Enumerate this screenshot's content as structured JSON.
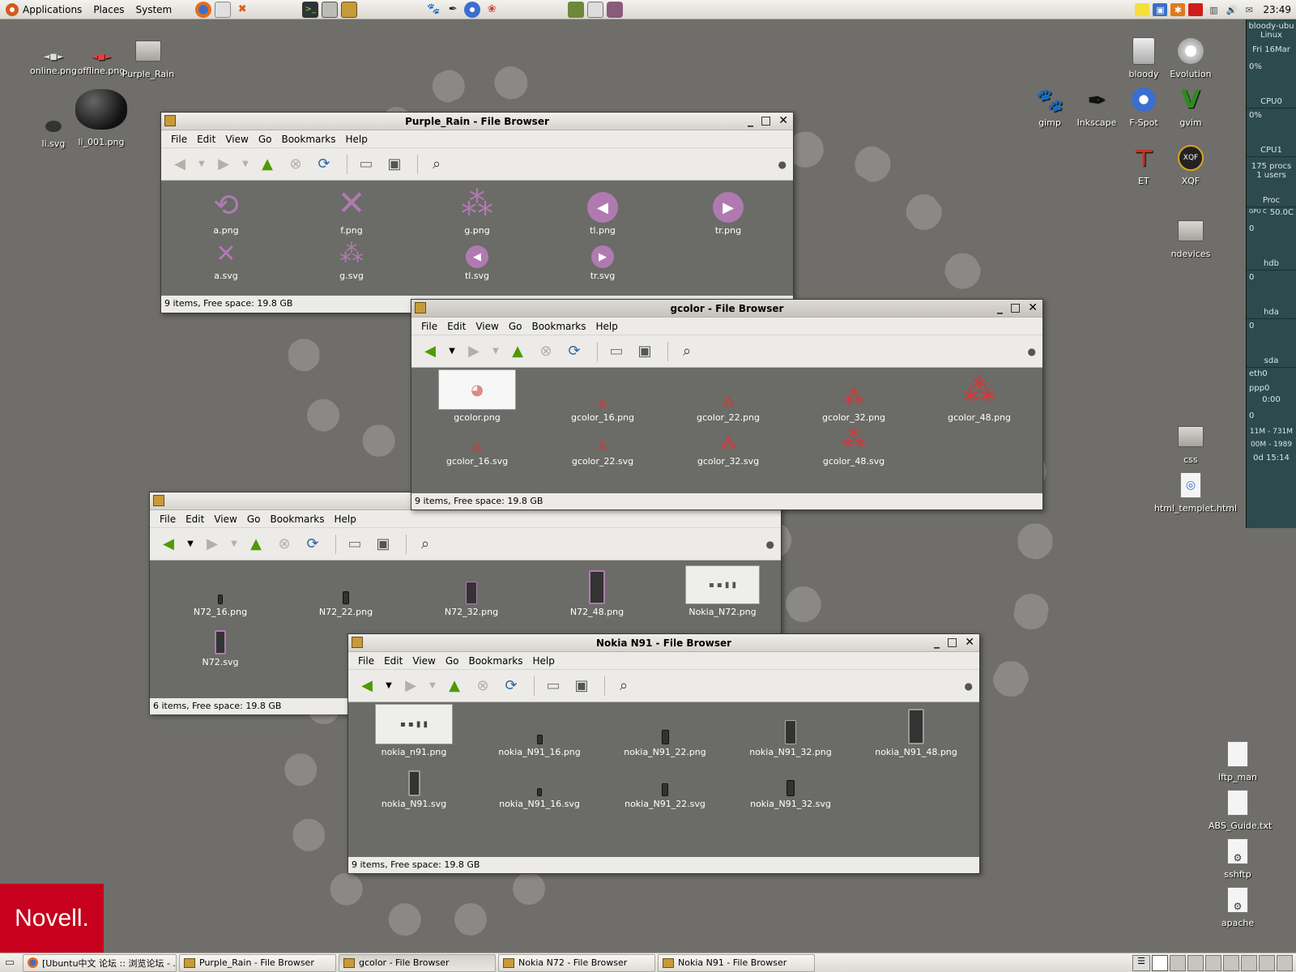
{
  "top_panel": {
    "menus": [
      "Applications",
      "Places",
      "System"
    ],
    "clock": "23:49"
  },
  "desktop_icons_left": [
    {
      "label": "online.png",
      "icon": "image-icon"
    },
    {
      "label": "offline.png",
      "icon": "image-icon"
    },
    {
      "label": "Purple_Rain",
      "icon": "folder-icon"
    },
    {
      "label": "li.svg",
      "icon": "mouse-icon"
    },
    {
      "label": "li_001.png",
      "icon": "mouse-icon"
    }
  ],
  "desktop_icons_right": [
    {
      "label": "bloody",
      "icon": "drive-icon"
    },
    {
      "label": "Evolution",
      "icon": "evolution-icon"
    },
    {
      "label": "gimp",
      "icon": "gimp-icon"
    },
    {
      "label": "Inkscape",
      "icon": "inkscape-icon"
    },
    {
      "label": "F-Spot",
      "icon": "fspot-icon"
    },
    {
      "label": "gvim",
      "icon": "gvim-icon"
    },
    {
      "label": "ET",
      "icon": "et-icon"
    },
    {
      "label": "XQF",
      "icon": "xqf-icon"
    },
    {
      "label": "ndevices",
      "icon": "folder-icon"
    },
    {
      "label": "css",
      "icon": "folder-icon"
    },
    {
      "label": "html_templet.html",
      "icon": "html-icon"
    },
    {
      "label": "lftp_man",
      "icon": "text-file-icon"
    },
    {
      "label": "ABS_Guide.txt",
      "icon": "text-file-icon"
    },
    {
      "label": "sshftp",
      "icon": "script-icon"
    },
    {
      "label": "apache",
      "icon": "script-icon"
    }
  ],
  "sidebar_monitor": {
    "host": "bloody-ubu Linux",
    "date": "Fri  16Mar",
    "cpu0_pct": "0%",
    "cpu0": "CPU0",
    "cpu1_pct": "0%",
    "cpu1": "CPU1",
    "procs": "175 procs 1 users",
    "proc": "Proc",
    "temp": "50.0C",
    "temp_label": "GPU C",
    "hdb_val": "0",
    "hdb": "hdb",
    "hda_val": "0",
    "hda": "hda",
    "sda_val": "0",
    "sda": "sda",
    "eth0": "eth0",
    "ppp0": "ppp0",
    "ppp0_time": "0:00",
    "mem_val": "0",
    "mem1": "11M - 731M",
    "mem2": "00M - 1989",
    "uptime": "0d 15:14"
  },
  "menu_labels": [
    "File",
    "Edit",
    "View",
    "Go",
    "Bookmarks",
    "Help"
  ],
  "windows": {
    "purple_rain": {
      "title": "Purple_Rain - File Browser",
      "status": "9 items, Free space: 19.8 GB",
      "files": [
        "a.png",
        "f.png",
        "g.png",
        "tl.png",
        "tr.png",
        "a.svg",
        "g.svg",
        "tl.svg",
        "tr.svg"
      ]
    },
    "gcolor": {
      "title": "gcolor - File Browser",
      "status": "9 items, Free space: 19.8 GB",
      "files": [
        "gcolor.png",
        "gcolor_16.png",
        "gcolor_22.png",
        "gcolor_32.png",
        "gcolor_48.png",
        "gcolor_16.svg",
        "gcolor_22.svg",
        "gcolor_32.svg",
        "gcolor_48.svg"
      ]
    },
    "nokia_n72": {
      "title": "Nokia N72 - File Browser",
      "title_visible": "No",
      "status": "6 items, Free space: 19.8 GB",
      "files": [
        "N72_16.png",
        "N72_22.png",
        "N72_32.png",
        "N72_48.png",
        "Nokia_N72.png",
        "N72.svg"
      ]
    },
    "nokia_n91": {
      "title": "Nokia N91 - File Browser",
      "status": "9 items, Free space: 19.8 GB",
      "files": [
        "nokia_n91.png",
        "nokia_N91_16.png",
        "nokia_N91_22.png",
        "nokia_N91_32.png",
        "nokia_N91_48.png",
        "nokia_N91.svg",
        "nokia_N91_16.svg",
        "nokia_N91_22.svg",
        "nokia_N91_32.svg"
      ]
    }
  },
  "taskbar": [
    "[Ubuntu中文 论坛 :: 浏览论坛 - ...",
    "Purple_Rain - File Browser",
    "gcolor - File Browser",
    "Nokia N72 - File Browser",
    "Nokia N91 - File Browser"
  ],
  "novell": "Novell.",
  "colors": {
    "desktop": "#6f6e6a",
    "purple": "#b07ab0",
    "novell_red": "#c6001d",
    "monitor_bg": "#2d4a4f"
  }
}
